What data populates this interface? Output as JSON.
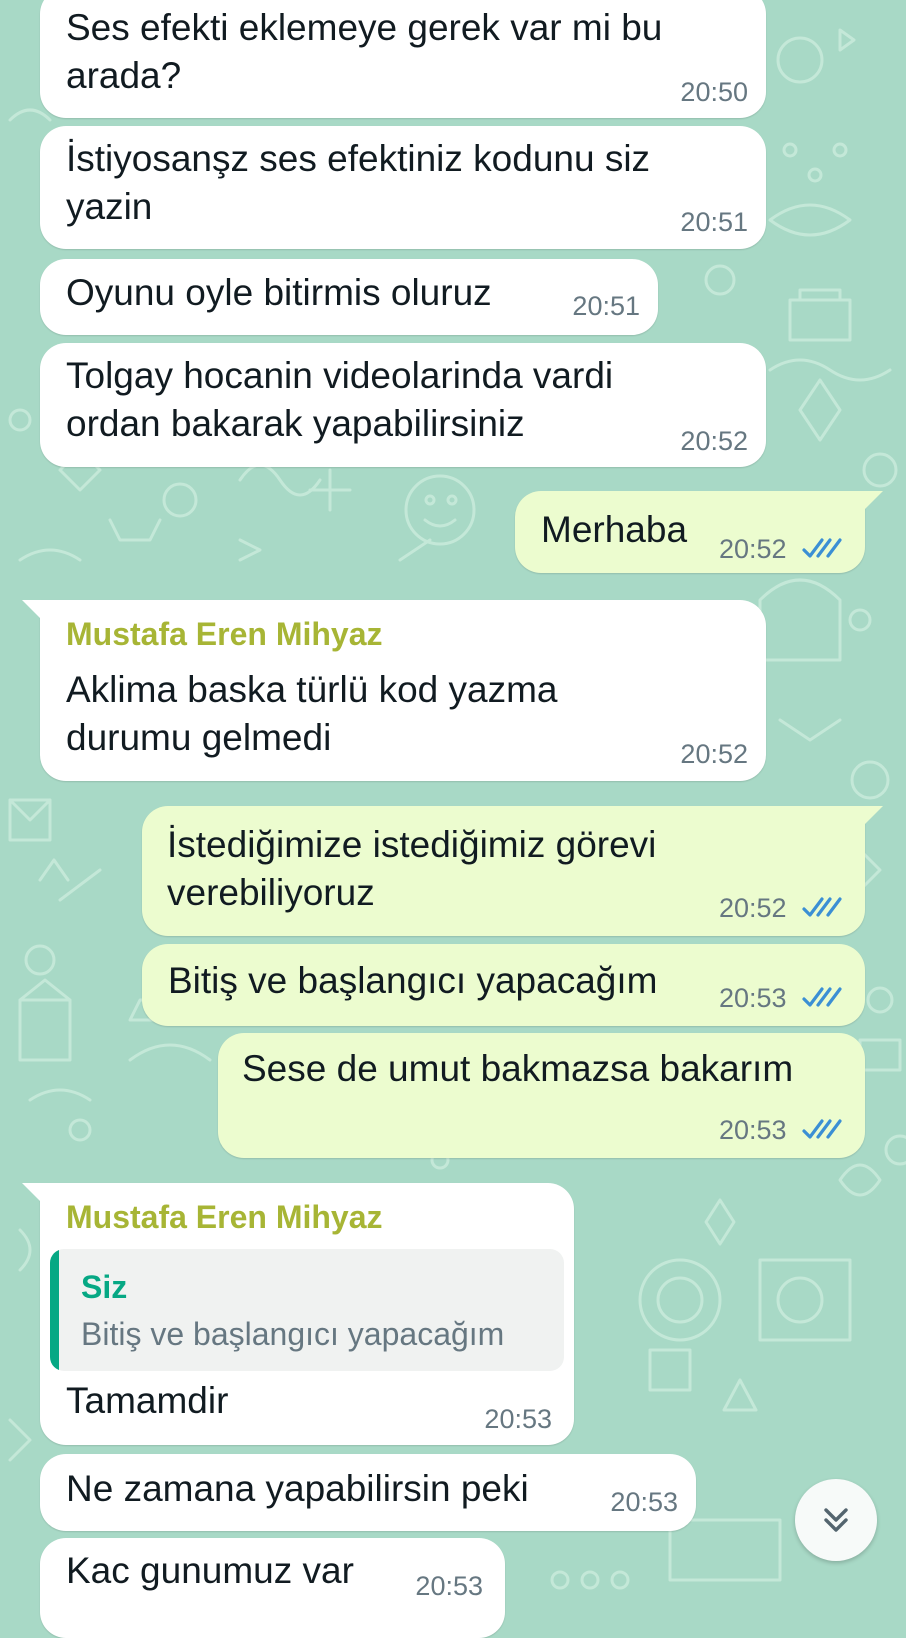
{
  "colors": {
    "wallpaper": "#a8d9c6",
    "wallpaper_doodle": "#c4e8d8",
    "incoming_bubble": "#ffffff",
    "outgoing_bubble": "#ecfccf",
    "sender_name": "#a7b535",
    "quote_accent": "#06a884",
    "read_ticks": "#3b8fd4",
    "timestamp": "#667781"
  },
  "messages": [
    {
      "direction": "incoming",
      "text": "Ses efekti eklemeye gerek var mi bu\narada?",
      "time": "20:50"
    },
    {
      "direction": "incoming",
      "text": "İstiyosanşz ses efektiniz kodunu siz\nyazin",
      "time": "20:51"
    },
    {
      "direction": "incoming",
      "text": "Oyunu oyle bitirmis oluruz",
      "time": "20:51"
    },
    {
      "direction": "incoming",
      "text": "Tolgay hocanin videolarinda vardi\nordan bakarak yapabilirsiniz",
      "time": "20:52"
    },
    {
      "direction": "outgoing",
      "text": "Merhaba",
      "time": "20:52",
      "status": "read"
    },
    {
      "direction": "incoming",
      "sender": "Mustafa Eren Mihyaz",
      "text": "Aklima baska türlü kod yazma\ndurumu gelmedi",
      "time": "20:52"
    },
    {
      "direction": "outgoing",
      "text": "İstediğimize istediğimiz görevi\nverebiliyoruz",
      "time": "20:52",
      "status": "read"
    },
    {
      "direction": "outgoing",
      "text": "Bitiş ve başlangıcı yapacağım",
      "time": "20:53",
      "status": "read"
    },
    {
      "direction": "outgoing",
      "text": "Sese de umut bakmazsa bakarım",
      "time": "20:53",
      "status": "read"
    },
    {
      "direction": "incoming",
      "sender": "Mustafa Eren Mihyaz",
      "quote": {
        "author": "Siz",
        "text": "Bitiş ve başlangıcı yapacağım"
      },
      "text": "Tamamdir",
      "time": "20:53"
    },
    {
      "direction": "incoming",
      "text": "Ne zamana yapabilirsin peki",
      "time": "20:53"
    },
    {
      "direction": "incoming",
      "text": "Kac gunumuz var",
      "time": "20:53"
    }
  ],
  "scroll_button": {
    "icon": "double-chevron-down-icon"
  }
}
